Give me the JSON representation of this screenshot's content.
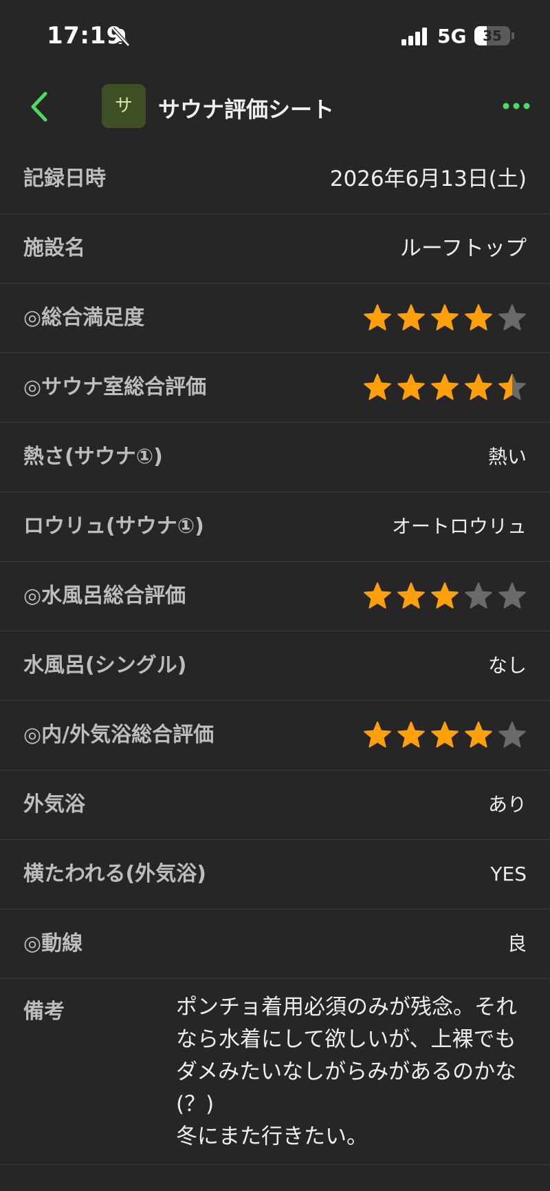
{
  "status_bar": {
    "time": "17:19",
    "network": "5G",
    "battery_level": "35",
    "battery_fraction": 0.35,
    "icons": [
      "bell-slash-icon",
      "cellular-signal-icon",
      "battery-icon"
    ]
  },
  "nav": {
    "back_icon": "chevron-left-icon",
    "app_icon_letter": "サ",
    "title": "サウナ評価シート",
    "more_icon": "ellipsis-icon",
    "accent_color": "#4cd964"
  },
  "colors": {
    "star_filled": "#ff9f0a",
    "star_empty": "#6a6a6a"
  },
  "rows": [
    {
      "label": "記録日時",
      "value": "2026年6月13日(土)"
    },
    {
      "label": "施設名",
      "value": "ルーフトップ"
    },
    {
      "label": "◎総合満足度",
      "rating": 4,
      "rating_max": 5
    },
    {
      "label": "◎サウナ室総合評価",
      "rating": 4.5,
      "rating_max": 5
    },
    {
      "label": "熱さ(サウナ①)",
      "value": "熱い"
    },
    {
      "label": "ロウリュ(サウナ①)",
      "value": "オートロウリュ"
    },
    {
      "label": "◎水風呂総合評価",
      "rating": 3,
      "rating_max": 5
    },
    {
      "label": "水風呂(シングル)",
      "value": "なし"
    },
    {
      "label": "◎内/外気浴総合評価",
      "rating": 4,
      "rating_max": 5
    },
    {
      "label": "外気浴",
      "value": "あり"
    },
    {
      "label": "横たわれる(外気浴)",
      "value": "YES"
    },
    {
      "label": "◎動線",
      "value": "良"
    }
  ],
  "note": {
    "label": "備考",
    "text": "ポンチョ着用必須のみが残念。それなら水着にして欲しいが、上裸でもダメみたいなしがらみがあるのかな(？)\n冬にまた行きたい。"
  }
}
